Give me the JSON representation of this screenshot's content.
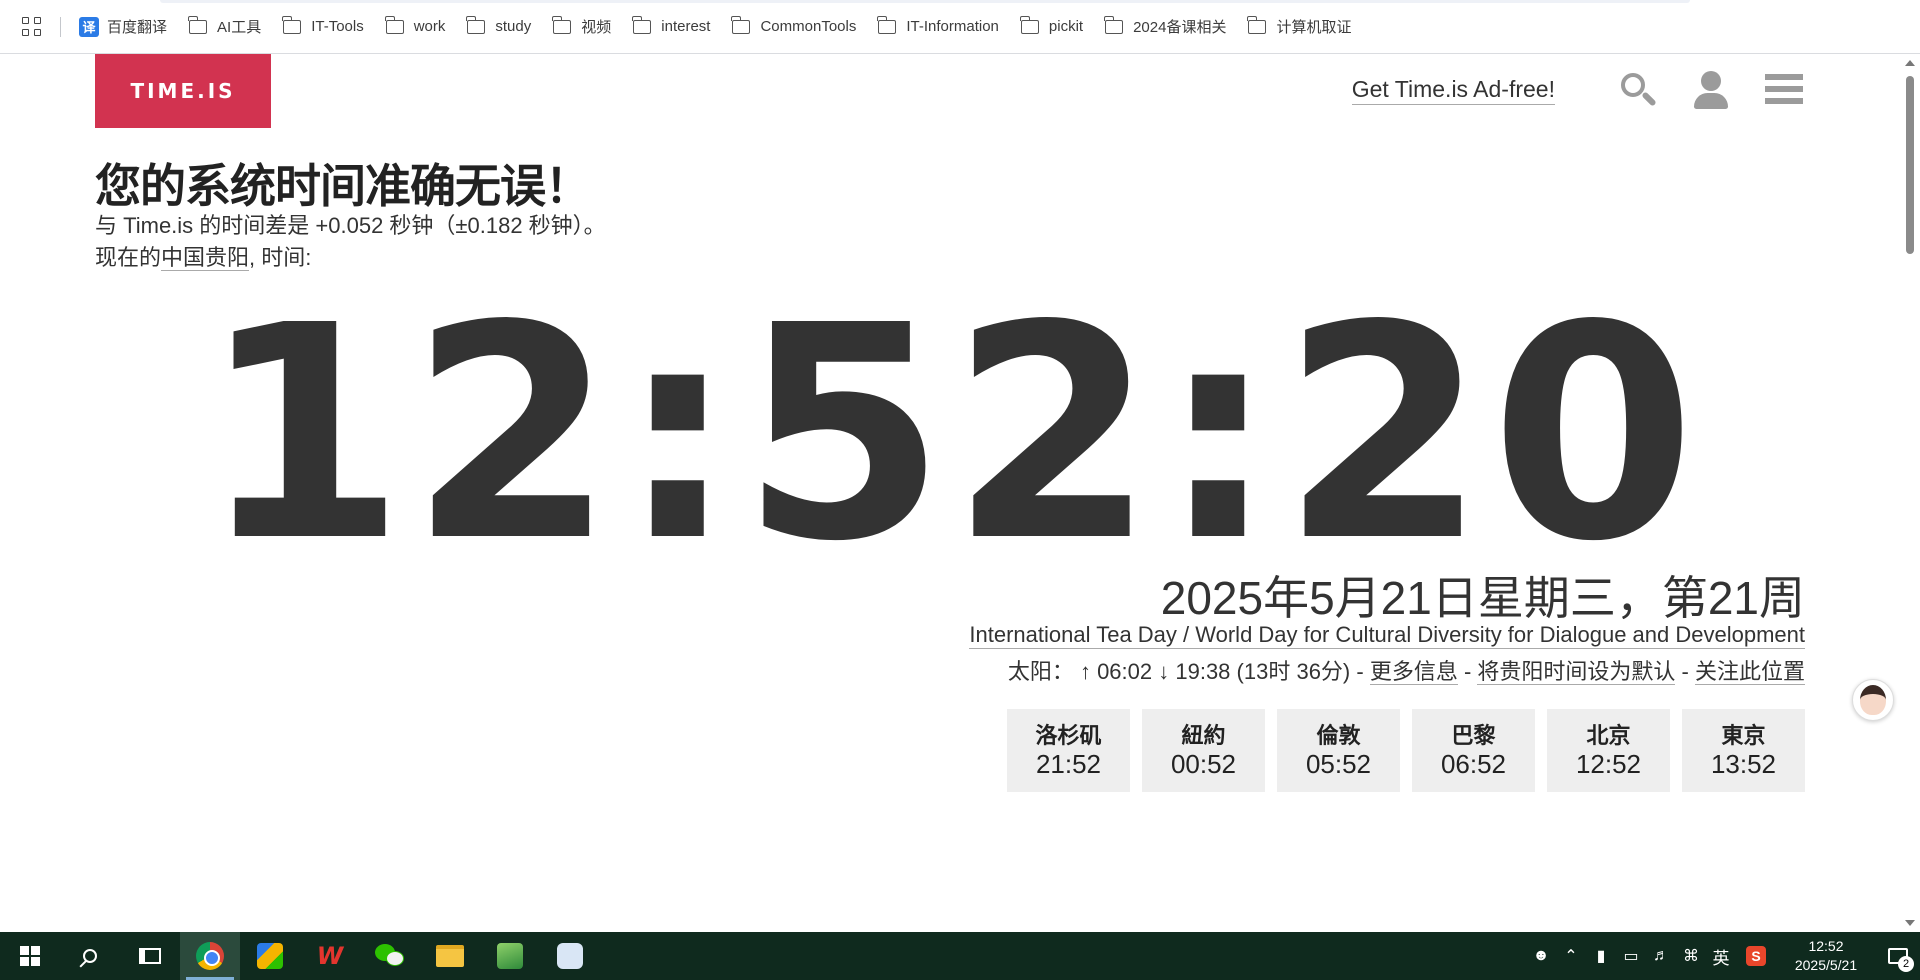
{
  "bookmarks": {
    "items": [
      {
        "label": "百度翻译",
        "icon": "translate-icon"
      },
      {
        "label": "AI工具",
        "icon": "folder-icon"
      },
      {
        "label": "IT-Tools",
        "icon": "folder-icon"
      },
      {
        "label": "work",
        "icon": "folder-icon"
      },
      {
        "label": "study",
        "icon": "folder-icon"
      },
      {
        "label": "视频",
        "icon": "folder-icon"
      },
      {
        "label": "interest",
        "icon": "folder-icon"
      },
      {
        "label": "CommonTools",
        "icon": "folder-icon"
      },
      {
        "label": "IT-Information",
        "icon": "folder-icon"
      },
      {
        "label": "pickit",
        "icon": "folder-icon"
      },
      {
        "label": "2024备课相关",
        "icon": "folder-icon"
      },
      {
        "label": "计算机取证",
        "icon": "folder-icon"
      }
    ],
    "translate_glyph": "译"
  },
  "header": {
    "logo": "TIME.IS",
    "adfree": "Get Time.is Ad-free!",
    "brand_color": "#d23350"
  },
  "status": {
    "headline": "您的系统时间准确无误！",
    "diff_line": "与 Time.is 的时间差是 +0.052 秒钟（±0.182 秒钟）。",
    "now_prefix": "现在的",
    "location": "中国贵阳",
    "now_suffix": ", 时间:"
  },
  "clock": {
    "time": "12:52:20"
  },
  "info": {
    "date": "2025年5月21日星期三，第21周",
    "holiday": "International Tea Day / World Day for Cultural Diversity for Dialogue and Development",
    "sun_label": "太阳：",
    "sunrise": "↑ 06:02",
    "sunset": "↓ 19:38",
    "daylength": "(13时 36分)",
    "sep": " - ",
    "more_info": "更多信息",
    "set_default": "将贵阳时间设为默认",
    "follow": "关注此位置"
  },
  "cities": [
    {
      "name": "洛杉矶",
      "time": "21:52"
    },
    {
      "name": "紐約",
      "time": "00:52"
    },
    {
      "name": "倫敦",
      "time": "05:52"
    },
    {
      "name": "巴黎",
      "time": "06:52"
    },
    {
      "name": "北京",
      "time": "12:52"
    },
    {
      "name": "東京",
      "time": "13:52"
    }
  ],
  "taskbar": {
    "wps_label": "W",
    "ime_lang": "英",
    "sogou_label": "S",
    "clock_time": "12:52",
    "clock_date": "2025/5/21",
    "notification_count": "2"
  }
}
